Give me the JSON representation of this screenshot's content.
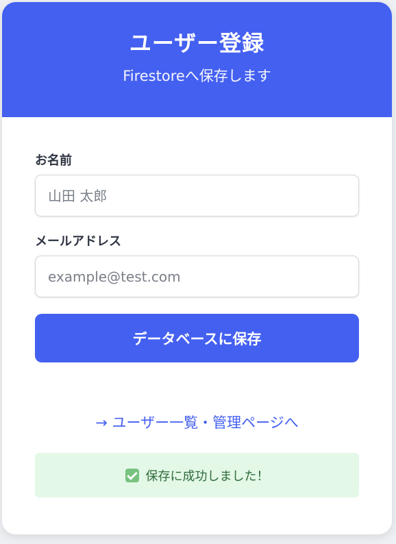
{
  "header": {
    "title": "ユーザー登録",
    "subtitle": "Firestoreへ保存します"
  },
  "form": {
    "name": {
      "label": "お名前",
      "placeholder": "山田 太郎",
      "value": ""
    },
    "email": {
      "label": "メールアドレス",
      "placeholder": "example@test.com",
      "value": ""
    },
    "submit_label": "データベースに保存"
  },
  "link": {
    "label": "→ ユーザー一覧・管理ページへ"
  },
  "status": {
    "icon": "check-mark-icon",
    "message": "保存に成功しました！",
    "color": "#2f6b3a",
    "background": "#e3f8e7"
  },
  "colors": {
    "accent": "#4460f1",
    "background": "#ffffff"
  }
}
